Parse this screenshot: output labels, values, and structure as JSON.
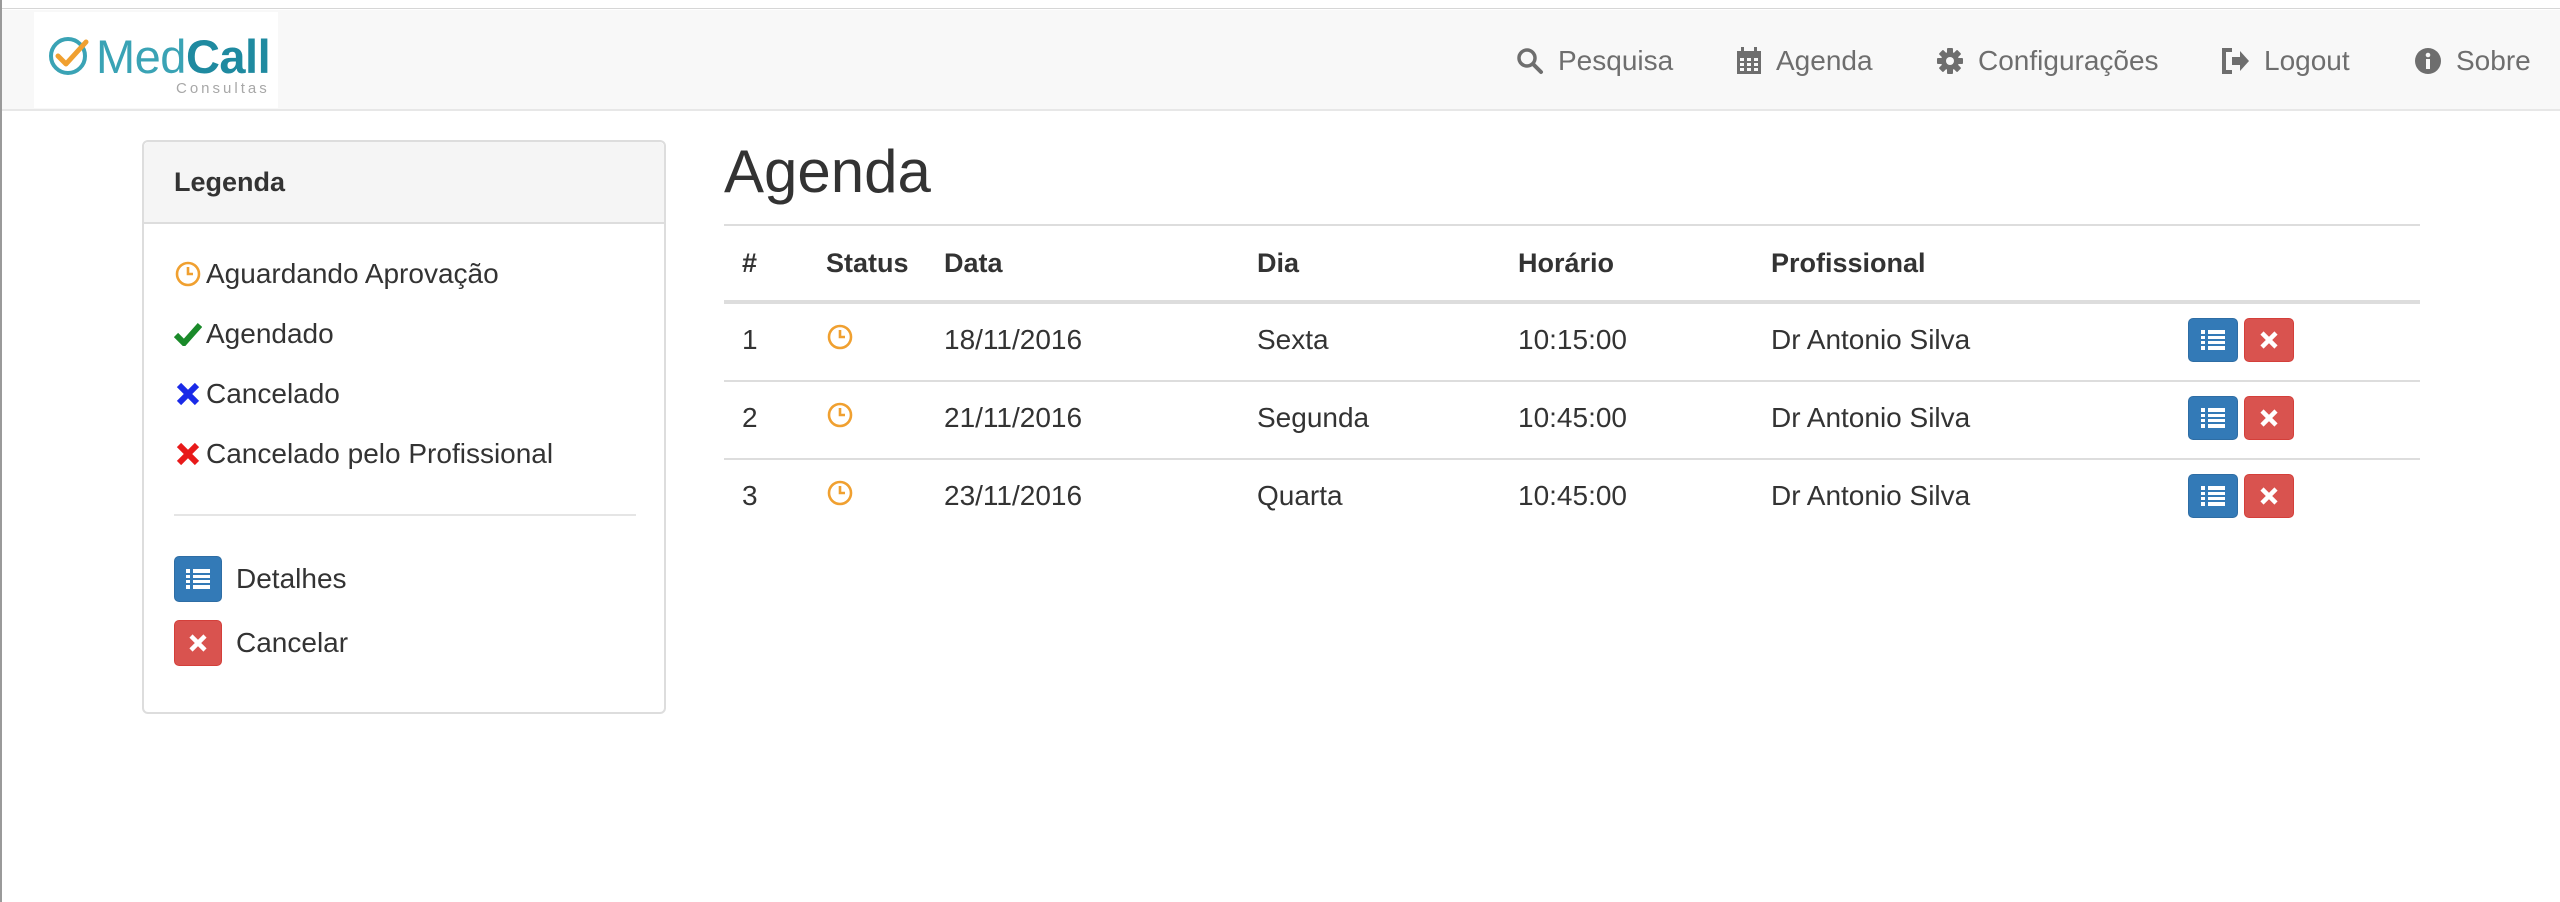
{
  "brand": {
    "part1": "Med",
    "part2": "Call",
    "subtitle": "Consultas"
  },
  "nav": [
    {
      "label": "Pesquisa",
      "icon": "search-icon"
    },
    {
      "label": "Agenda",
      "icon": "calendar-icon"
    },
    {
      "label": "Configurações",
      "icon": "gear-icon"
    },
    {
      "label": "Logout",
      "icon": "logout-icon"
    },
    {
      "label": "Sobre",
      "icon": "info-icon"
    }
  ],
  "legend": {
    "title": "Legenda",
    "statuses": [
      {
        "label": "Aguardando Aprovação",
        "icon": "clock-icon",
        "color": "#f0a030"
      },
      {
        "label": "Agendado",
        "icon": "check-icon",
        "color": "#1a8a2a"
      },
      {
        "label": "Cancelado",
        "icon": "x-icon",
        "color": "#1a2ae8"
      },
      {
        "label": "Cancelado pelo Profissional",
        "icon": "x-icon",
        "color": "#e81a1a"
      }
    ],
    "actions": [
      {
        "label": "Detalhes",
        "icon": "list-icon",
        "color": "#337ab7"
      },
      {
        "label": "Cancelar",
        "icon": "remove-icon",
        "color": "#d9534f"
      }
    ]
  },
  "page": {
    "title": "Agenda"
  },
  "table": {
    "headers": {
      "num": "#",
      "status": "Status",
      "data": "Data",
      "dia": "Dia",
      "horario": "Horário",
      "profissional": "Profissional"
    },
    "rows": [
      {
        "num": "1",
        "status": "Aguardando Aprovação",
        "data": "18/11/2016",
        "dia": "Sexta",
        "horario": "10:15:00",
        "profissional": "Dr Antonio Silva"
      },
      {
        "num": "2",
        "status": "Aguardando Aprovação",
        "data": "21/11/2016",
        "dia": "Segunda",
        "horario": "10:45:00",
        "profissional": "Dr Antonio Silva"
      },
      {
        "num": "3",
        "status": "Aguardando Aprovação",
        "data": "23/11/2016",
        "dia": "Quarta",
        "horario": "10:45:00",
        "profissional": "Dr Antonio Silva"
      }
    ]
  },
  "colors": {
    "primary": "#337ab7",
    "danger": "#d9534f",
    "pending": "#f0a030",
    "brand": "#1f8aa0"
  }
}
